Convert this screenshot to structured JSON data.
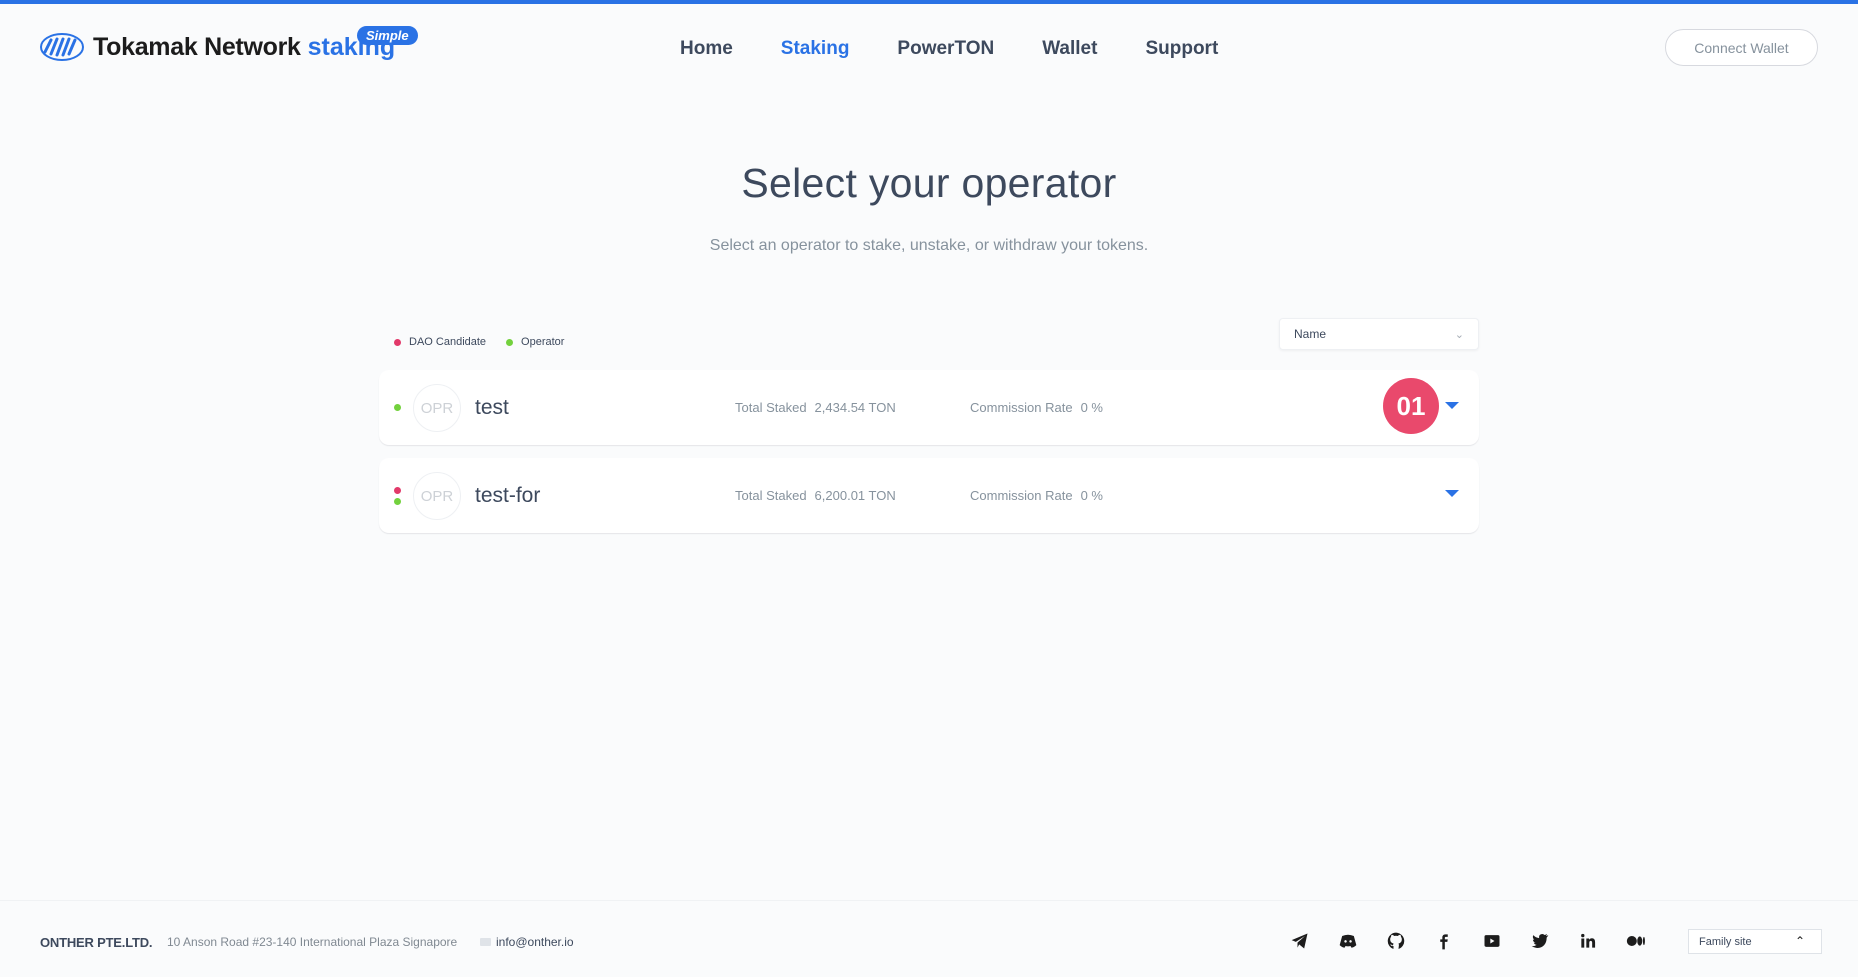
{
  "brand": {
    "name": "Tokamak Network",
    "product": "staking",
    "badge": "Simple"
  },
  "nav": {
    "items": [
      {
        "label": "Home",
        "active": false
      },
      {
        "label": "Staking",
        "active": true
      },
      {
        "label": "PowerTON",
        "active": false
      },
      {
        "label": "Wallet",
        "active": false
      },
      {
        "label": "Support",
        "active": false
      }
    ],
    "connect_wallet": "Connect Wallet"
  },
  "page": {
    "title": "Select your operator",
    "subtitle": "Select an operator to stake, unstake, or withdraw your tokens."
  },
  "legend": {
    "dao_candidate": "DAO Candidate",
    "operator": "Operator"
  },
  "sort": {
    "value": "Name"
  },
  "operators": [
    {
      "avatar": "OPR",
      "name": "test",
      "total_staked_label": "Total Staked",
      "total_staked": "2,434.54 TON",
      "commission_label": "Commission Rate",
      "commission": "0 %",
      "badge": "01"
    },
    {
      "avatar": "OPR",
      "name": "test-for",
      "total_staked_label": "Total Staked",
      "total_staked": "6,200.01 TON",
      "commission_label": "Commission Rate",
      "commission": "0 %"
    }
  ],
  "footer": {
    "company": "ONTHER PTE.LTD.",
    "address": "10 Anson Road #23-140 International Plaza Signapore",
    "email": "info@onther.io",
    "family_site": "Family site",
    "socials": [
      "telegram-icon",
      "discord-icon",
      "github-icon",
      "facebook-icon",
      "youtube-icon",
      "twitter-icon",
      "linkedin-icon",
      "medium-icon"
    ]
  },
  "colors": {
    "accent": "#2a72e5",
    "dao": "#e2396a",
    "operator": "#73d13d",
    "badge": "#e9496c"
  }
}
